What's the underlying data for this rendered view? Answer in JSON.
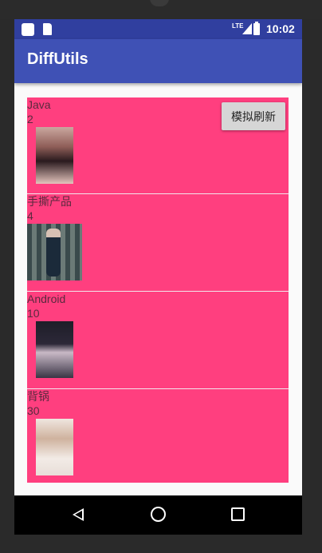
{
  "status_bar": {
    "network": "LTE",
    "time": "10:02"
  },
  "app_bar": {
    "title": "DiffUtils"
  },
  "list": {
    "items": [
      {
        "title": "Java",
        "count": "2",
        "icon": "portrait-photo"
      },
      {
        "title": "手撕产品",
        "count": "4",
        "icon": "portrait-photo"
      },
      {
        "title": "Android",
        "count": "10",
        "icon": "portrait-photo"
      },
      {
        "title": "背锅",
        "count": "30",
        "icon": "portrait-photo"
      }
    ],
    "background_color": "#ff3f7f"
  },
  "refresh_button": {
    "label": "模拟刷新"
  },
  "nav_bar": {
    "back": "back-icon",
    "home": "home-icon",
    "recents": "recents-icon"
  },
  "colors": {
    "status_bar": "#303f9f",
    "app_bar": "#3f51b5",
    "accent": "#ff3f7f"
  }
}
